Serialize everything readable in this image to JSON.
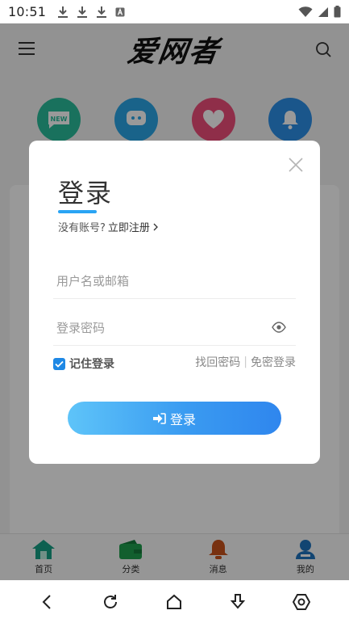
{
  "status_bar": {
    "time": "10:51"
  },
  "header": {
    "logo": "爱网者"
  },
  "tabs": [
    {
      "label": "首页",
      "icon": "home-icon",
      "color": "#16a085"
    },
    {
      "label": "分类",
      "icon": "wallet-icon",
      "color": "#1f9f4d"
    },
    {
      "label": "消息",
      "icon": "bell-icon",
      "color": "#c9521b"
    },
    {
      "label": "我的",
      "icon": "user-icon",
      "color": "#1e73be"
    }
  ],
  "modal": {
    "title": "登录",
    "register_prompt": "没有账号?",
    "register_link": "立即注册",
    "username_placeholder": "用户名或邮箱",
    "password_placeholder": "登录密码",
    "remember_label": "记住登录",
    "remember_checked": true,
    "forgot_password": "找回密码",
    "separator": "|",
    "passwordless_login": "免密登录",
    "login_button": "登录"
  },
  "colors": {
    "accent": "#2aa4f4",
    "button_start": "#5ec4f9",
    "button_end": "#2f86ee",
    "checkbox": "#1e88e5"
  }
}
